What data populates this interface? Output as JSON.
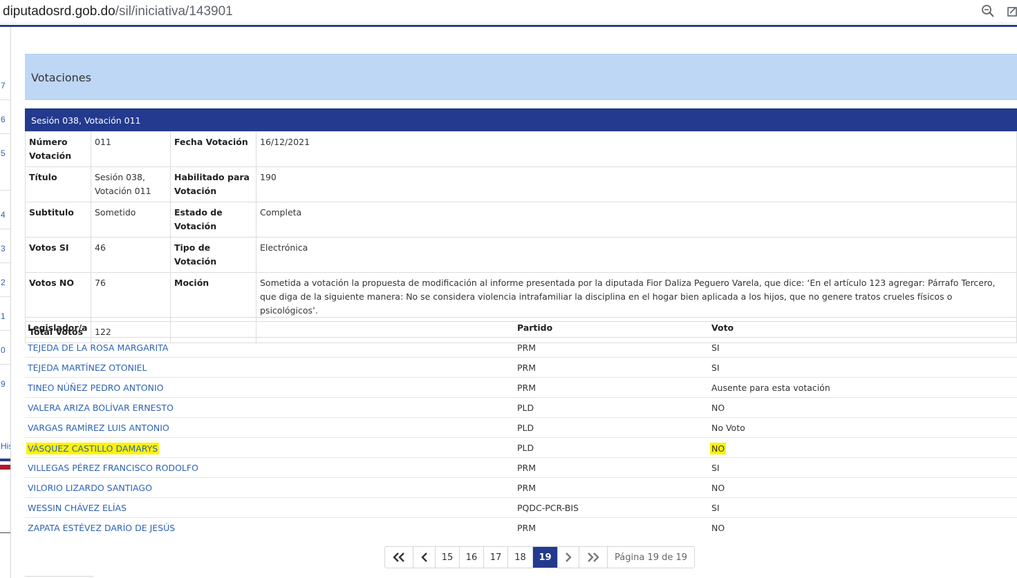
{
  "browser": {
    "url_host": "diputadosrd.gob.do",
    "url_path": "/sil/iniciativa/143901",
    "zoom_icon": "magnifier-minus-icon",
    "share_icon": "share-icon"
  },
  "backdrop": {
    "numbers": [
      "7",
      "6",
      "5",
      "4",
      "3",
      "2",
      "1",
      "0",
      "9"
    ],
    "link_fragment": "His"
  },
  "modal": {
    "header": "Votaciones",
    "session_title": "Sesión 038, Votación 011",
    "details": {
      "numero_label": "Número Votación",
      "numero_value": "011",
      "fecha_label": "Fecha Votación",
      "fecha_value": "16/12/2021",
      "titulo_label": "Título",
      "titulo_value": "Sesión 038, Votación 011",
      "habilitado_label": "Habilitado para Votación",
      "habilitado_value": "190",
      "subtitulo_label": "Subtitulo",
      "subtitulo_value": "Sometido",
      "estado_label": "Estado de Votación",
      "estado_value": "Completa",
      "votos_si_label": "Votos SI",
      "votos_si_value": "46",
      "tipo_label": "Tipo de Votación",
      "tipo_value": "Electrónica",
      "votos_no_label": "Votos NO",
      "votos_no_value": "76",
      "mocion_label": "Moción",
      "mocion_value": "Sometida a votación la propuesta de modificación al informe presentada por la diputada Fior Daliza Peguero Varela, que dice: ‘En el artículo 123 agregar: Párrafo Tercero, que diga de la siguiente manera: No se considera violencia intrafamiliar la disciplina en el hogar bien aplicada a los hijos, que no genere tratos crueles físicos o psicológicos’.",
      "total_label": "Total Votos",
      "total_value": "122"
    },
    "results": {
      "columns": [
        "Legislador/a",
        "Partido",
        "Voto"
      ],
      "rows": [
        {
          "name": "TEJEDA DE LA ROSA MARGARITA",
          "party": "PRM",
          "vote": "SI"
        },
        {
          "name": "TEJEDA MARTÍNEZ OTONIEL",
          "party": "PRM",
          "vote": "SI"
        },
        {
          "name": "TINEO NÚÑEZ PEDRO ANTONIO",
          "party": "PRM",
          "vote": "Ausente para esta votación"
        },
        {
          "name": "VALERA ARIZA BOLÍVAR ERNESTO",
          "party": "PLD",
          "vote": "NO"
        },
        {
          "name": "VARGAS RAMÍREZ LUIS ANTONIO",
          "party": "PLD",
          "vote": "No Voto"
        },
        {
          "name": "VÁSQUEZ CASTILLO DAMARYS",
          "party": "PLD",
          "vote": "NO"
        },
        {
          "name": "VILLEGAS PÉREZ FRANCISCO RODOLFO",
          "party": "PRM",
          "vote": "SI"
        },
        {
          "name": "VILORIO LIZARDO SANTIAGO",
          "party": "PRM",
          "vote": "NO"
        },
        {
          "name": "WESSIN CHÁVEZ ELÍAS",
          "party": "PQDC-PCR-BIS",
          "vote": "SI"
        },
        {
          "name": "ZAPATA ESTÉVEZ DARÍO DE JESÚS",
          "party": "PRM",
          "vote": "NO"
        }
      ],
      "highlight_color": "#fff200"
    },
    "pagination": {
      "pages": [
        "15",
        "16",
        "17",
        "18",
        "19"
      ],
      "active_page": "19",
      "info": "Página 19 de 19",
      "first_icon": "double-chevron-left-icon",
      "prev_icon": "chevron-left-icon",
      "next_icon": "chevron-right-icon",
      "last_icon": "double-chevron-right-icon"
    }
  },
  "colors": {
    "session_bar": "#233a8e",
    "header_bg": "#bdd7f5",
    "link": "#2d62b5"
  }
}
